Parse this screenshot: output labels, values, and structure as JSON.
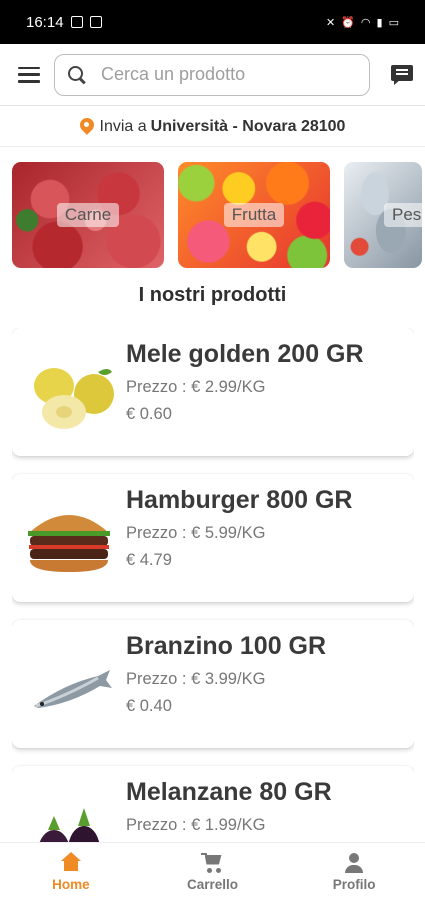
{
  "status_bar": {
    "time": "16:14"
  },
  "header": {
    "search_placeholder": "Cerca un prodotto"
  },
  "delivery": {
    "prefix": "Invia a",
    "place": "Università - Novara 28100"
  },
  "categories": [
    {
      "label": "Carne"
    },
    {
      "label": "Frutta"
    },
    {
      "label": "Pesce"
    }
  ],
  "section_title": "I nostri prodotti",
  "products": [
    {
      "name": "Mele golden 200 GR",
      "price_kg": "Prezzo : € 2.99/KG",
      "price": "€ 0.60"
    },
    {
      "name": "Hamburger 800 GR",
      "price_kg": "Prezzo : € 5.99/KG",
      "price": "€ 4.79"
    },
    {
      "name": "Branzino 100 GR",
      "price_kg": "Prezzo : € 3.99/KG",
      "price": "€ 0.40"
    },
    {
      "name": "Melanzane 80 GR",
      "price_kg": "Prezzo : € 1.99/KG",
      "price": ""
    }
  ],
  "nav": [
    {
      "label": "Home",
      "icon": "home-icon",
      "active": true
    },
    {
      "label": "Carrello",
      "icon": "cart-icon",
      "active": false
    },
    {
      "label": "Profilo",
      "icon": "profile-icon",
      "active": false
    }
  ],
  "colors": {
    "accent": "#f08a24",
    "text": "#333333",
    "muted": "#777777"
  }
}
